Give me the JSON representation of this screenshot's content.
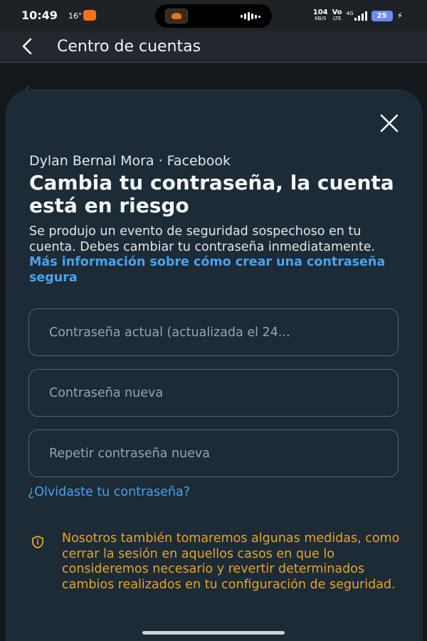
{
  "status_bar": {
    "time": "10:49",
    "temperature": "16°",
    "speed_value": "104",
    "speed_unit": "KB/S",
    "volte_top": "Vo",
    "volte_bottom": "LTE",
    "network": "4G",
    "battery": "25"
  },
  "header": {
    "title": "Centro de cuentas"
  },
  "sheet": {
    "account_line": "Dylan Bernal Mora · Facebook",
    "title": "Cambia tu contraseña, la cuenta está en riesgo",
    "description": "Se produjo un evento de seguridad sospechoso en tu cuenta. Debes cambiar tu contraseña inmediatamente.",
    "learn_more_link": "Más información sobre cómo crear una contraseña segura",
    "fields": [
      {
        "placeholder": "Contraseña actual (actualizada el 24...",
        "value": ""
      },
      {
        "placeholder": "Contraseña nueva",
        "value": ""
      },
      {
        "placeholder": "Repetir contraseña nueva",
        "value": ""
      }
    ],
    "forgot_link": "¿Olvidaste tu contraseña?",
    "notice_text": "Nosotros también tomaremos algunas medidas, como cerrar la sesión en aquellos casos en que lo consideremos necesario y revertir determinados cambios realizados en tu configuración de seguridad."
  },
  "colors": {
    "link": "#4aa2ee",
    "warning": "#e6a32a",
    "sheet_bg": "#1c2b36"
  },
  "icons": {
    "back": "back-arrow-icon",
    "close": "close-icon",
    "notice": "info-icon"
  }
}
